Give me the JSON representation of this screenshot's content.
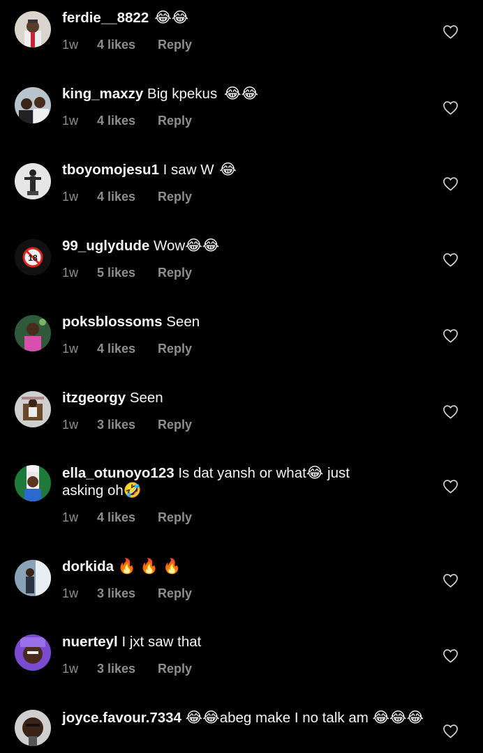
{
  "comments": [
    {
      "username": "ferdie__8822",
      "text": "",
      "emoji": "😂😂",
      "emoji2": "",
      "age": "1w",
      "likes": "4 likes",
      "reply": "Reply"
    },
    {
      "username": "king_maxzy",
      "text": " Big kpekus ",
      "emoji": "😂😂",
      "emoji2": "",
      "age": "1w",
      "likes": "4 likes",
      "reply": "Reply"
    },
    {
      "username": "tboyomojesu1",
      "text": " I saw W ",
      "emoji": "😂",
      "emoji2": "",
      "age": "1w",
      "likes": "4 likes",
      "reply": "Reply"
    },
    {
      "username": "99_uglydude",
      "text": " Wow",
      "emoji": "😂😂",
      "emoji2": "",
      "age": "1w",
      "likes": "5 likes",
      "reply": "Reply"
    },
    {
      "username": "poksblossoms",
      "text": " Seen",
      "emoji": "",
      "emoji2": "",
      "age": "1w",
      "likes": "4 likes",
      "reply": "Reply"
    },
    {
      "username": "itzgeorgy",
      "text": " Seen",
      "emoji": "",
      "emoji2": "",
      "age": "1w",
      "likes": "3 likes",
      "reply": "Reply"
    },
    {
      "username": "ella_otunoyo123",
      "text": " Is dat yansh or what",
      "emoji": "😂",
      "text2": " just asking oh",
      "emoji2": "🤣",
      "age": "1w",
      "likes": "4 likes",
      "reply": "Reply"
    },
    {
      "username": "dorkida",
      "text": " ",
      "emoji": "🔥🔥🔥",
      "emoji2": "",
      "age": "1w",
      "likes": "3 likes",
      "reply": "Reply"
    },
    {
      "username": "nuerteyl",
      "text": " I jxt saw that",
      "emoji": "",
      "emoji2": "",
      "age": "1w",
      "likes": "3 likes",
      "reply": "Reply"
    },
    {
      "username": "joyce.favour.7334",
      "text": " ",
      "emoji": "😂😂",
      "text2": "abeg make I no talk am ",
      "emoji2": "😂😂😂",
      "age": "",
      "likes": "",
      "reply": ""
    }
  ],
  "colors": {
    "background": "#000000",
    "text": "#f5f5f5",
    "muted": "#8e8e8e"
  },
  "icons": {
    "like": "heart-outline-icon"
  }
}
